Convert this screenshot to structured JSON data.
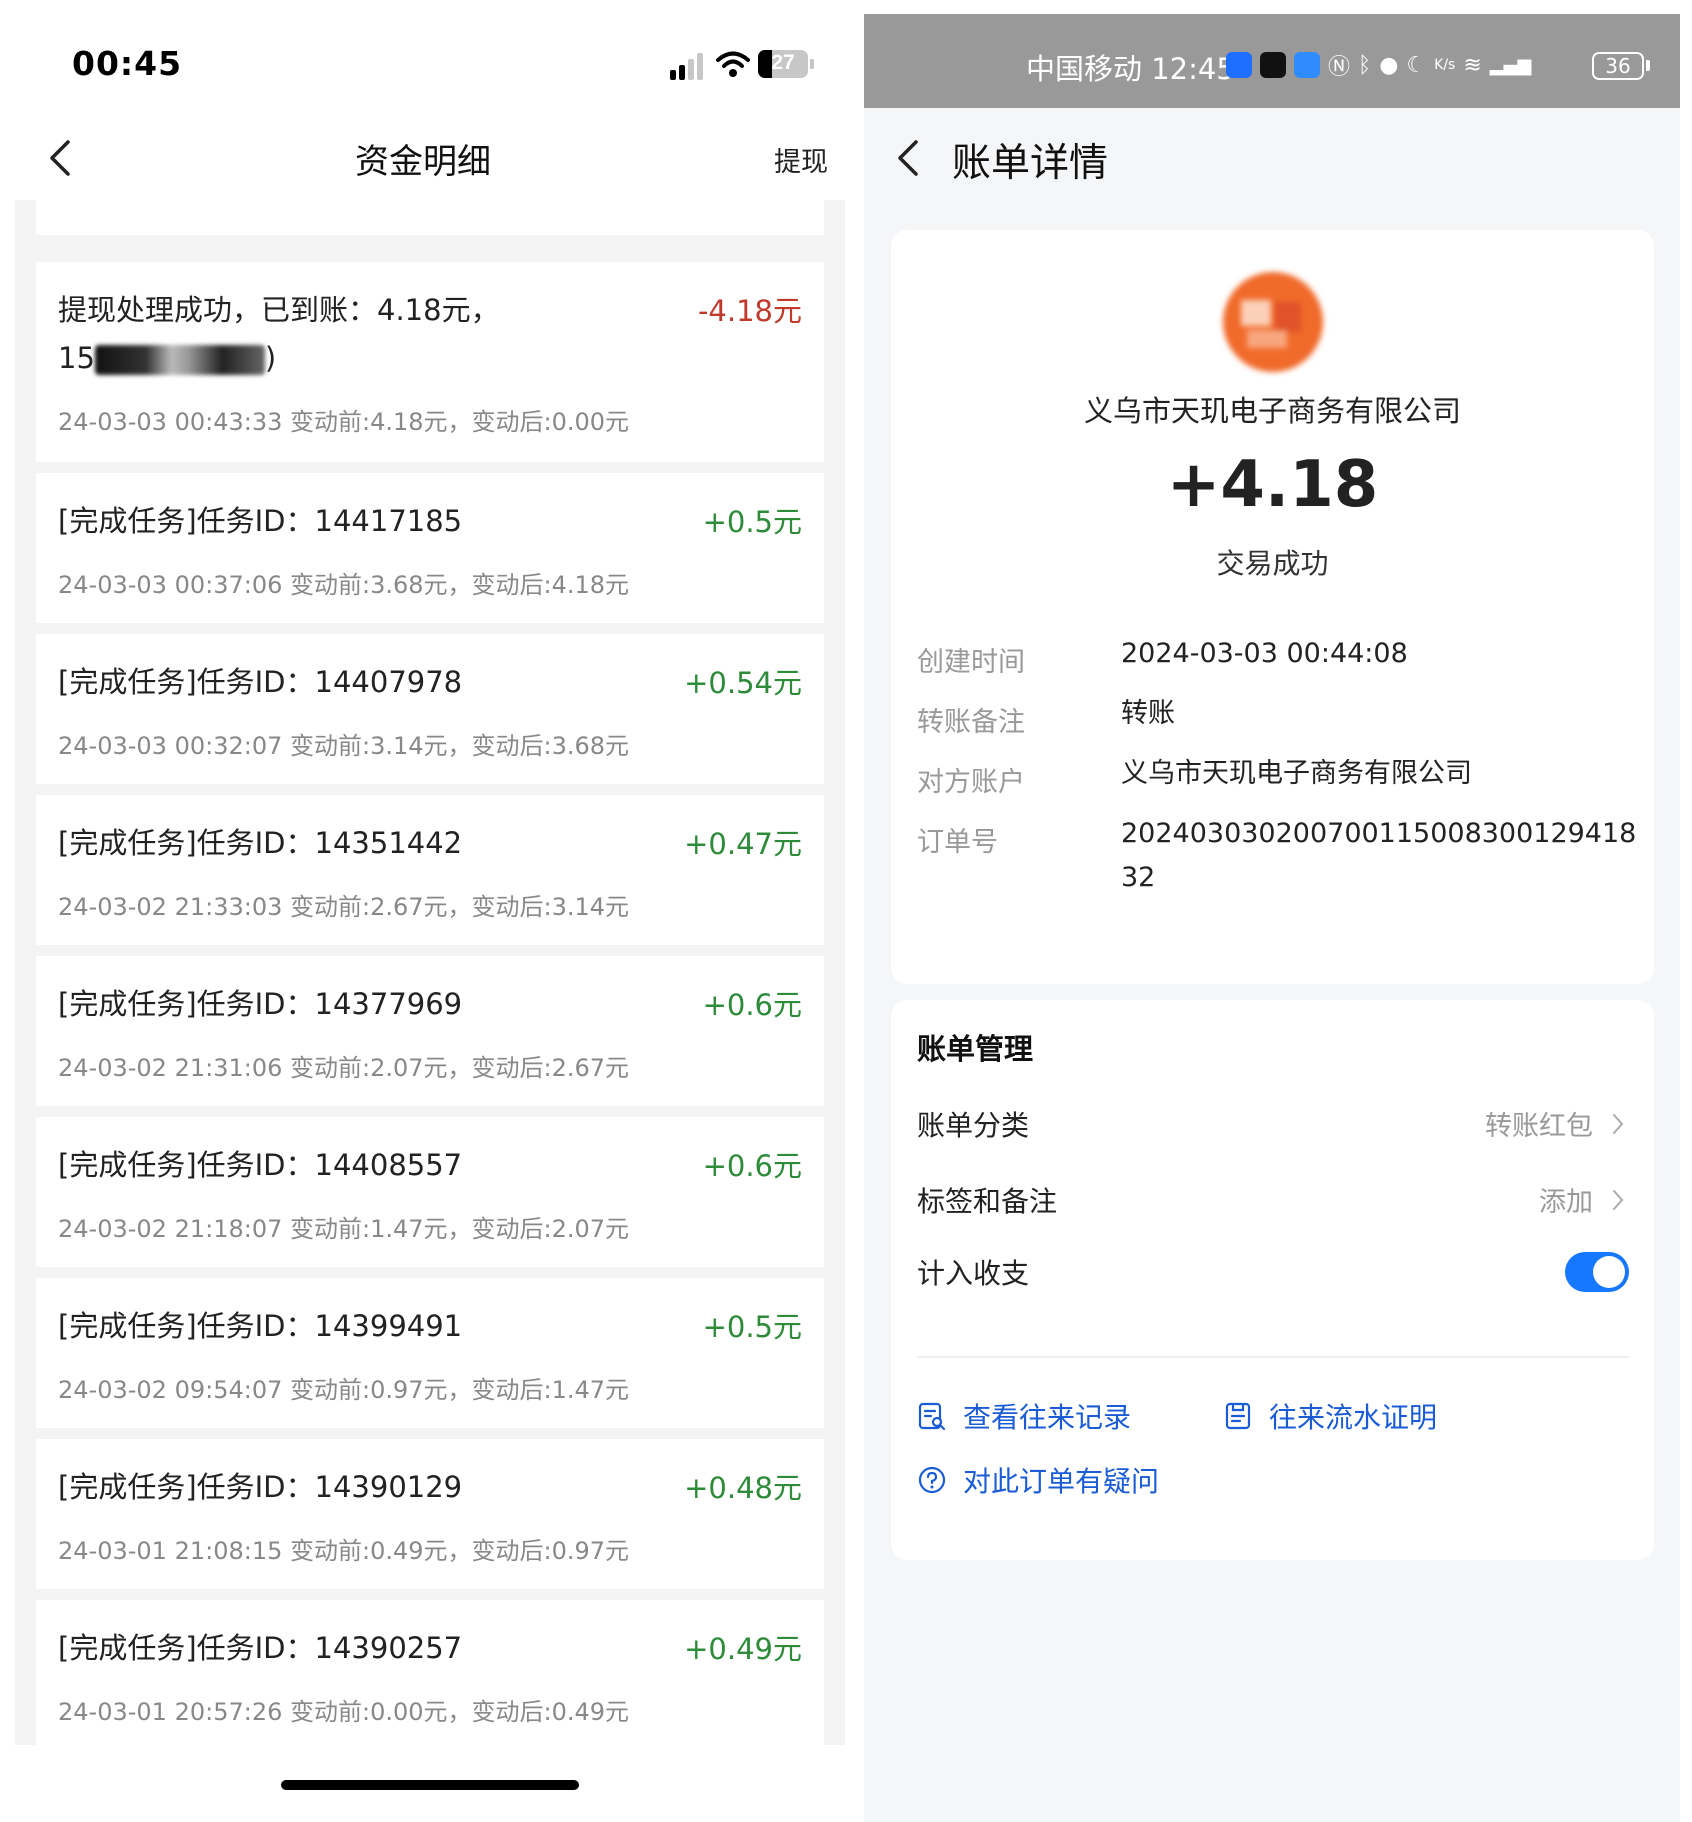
{
  "left": {
    "status_bar": {
      "time": "00:45",
      "battery": "27"
    },
    "nav": {
      "title": "资金明细",
      "action": "提现"
    },
    "records": [
      {
        "desc_line1": "提现处理成功，已到账：4.18元，",
        "desc_line2_start": "15",
        "desc_line2_end": ")",
        "amount": "-4.18元",
        "meta": "24-03-03 00:43:33  变动前:4.18元，变动后:0.00元"
      },
      {
        "desc_line1": "[完成任务]任务ID：14417185",
        "amount": "+0.5元",
        "meta": "24-03-03 00:37:06  变动前:3.68元，变动后:4.18元"
      },
      {
        "desc_line1": "[完成任务]任务ID：14407978",
        "amount": "+0.54元",
        "meta": "24-03-03 00:32:07  变动前:3.14元，变动后:3.68元"
      },
      {
        "desc_line1": "[完成任务]任务ID：14351442",
        "amount": "+0.47元",
        "meta": "24-03-02 21:33:03  变动前:2.67元，变动后:3.14元"
      },
      {
        "desc_line1": "[完成任务]任务ID：14377969",
        "amount": "+0.6元",
        "meta": "24-03-02 21:31:06  变动前:2.07元，变动后:2.67元"
      },
      {
        "desc_line1": "[完成任务]任务ID：14408557",
        "amount": "+0.6元",
        "meta": "24-03-02 21:18:07  变动前:1.47元，变动后:2.07元"
      },
      {
        "desc_line1": "[完成任务]任务ID：14399491",
        "amount": "+0.5元",
        "meta": "24-03-02 09:54:07  变动前:0.97元，变动后:1.47元"
      },
      {
        "desc_line1": "[完成任务]任务ID：14390129",
        "amount": "+0.48元",
        "meta": "24-03-01 21:08:15  变动前:0.49元，变动后:0.97元"
      },
      {
        "desc_line1": "[完成任务]任务ID：14390257",
        "amount": "+0.49元",
        "meta": "24-03-01 20:57:26  变动前:0.00元，变动后:0.49元"
      }
    ]
  },
  "right": {
    "status_bar": {
      "carrier_time": "中国移动 12:45",
      "battery": "36"
    },
    "nav": {
      "title": "账单详情"
    },
    "summary": {
      "merchant": "义乌市天玑电子商务有限公司",
      "amount": "+4.18",
      "status": "交易成功"
    },
    "details": [
      {
        "key": "创建时间",
        "value": "2024-03-03 00:44:08"
      },
      {
        "key": "转账备注",
        "value": "转账"
      },
      {
        "key": "对方账户",
        "value": "义乌市天玑电子商务有限公司"
      },
      {
        "key": "订单号",
        "value": "20240303020070011500830012941832"
      }
    ],
    "management": {
      "title": "账单管理",
      "category_label": "账单分类",
      "category_value": "转账红包",
      "tags_label": "标签和备注",
      "tags_value": "添加",
      "include_label": "计入收支",
      "include_on": true
    },
    "actions": {
      "history": "查看往来记录",
      "proof": "往来流水证明",
      "question": "对此订单有疑问"
    }
  },
  "colors": {
    "negative": "#c0392b",
    "positive": "#2e8b3a",
    "link": "#1a5bd6",
    "toggle_on": "#1677ff",
    "status_gray": "#999999"
  }
}
